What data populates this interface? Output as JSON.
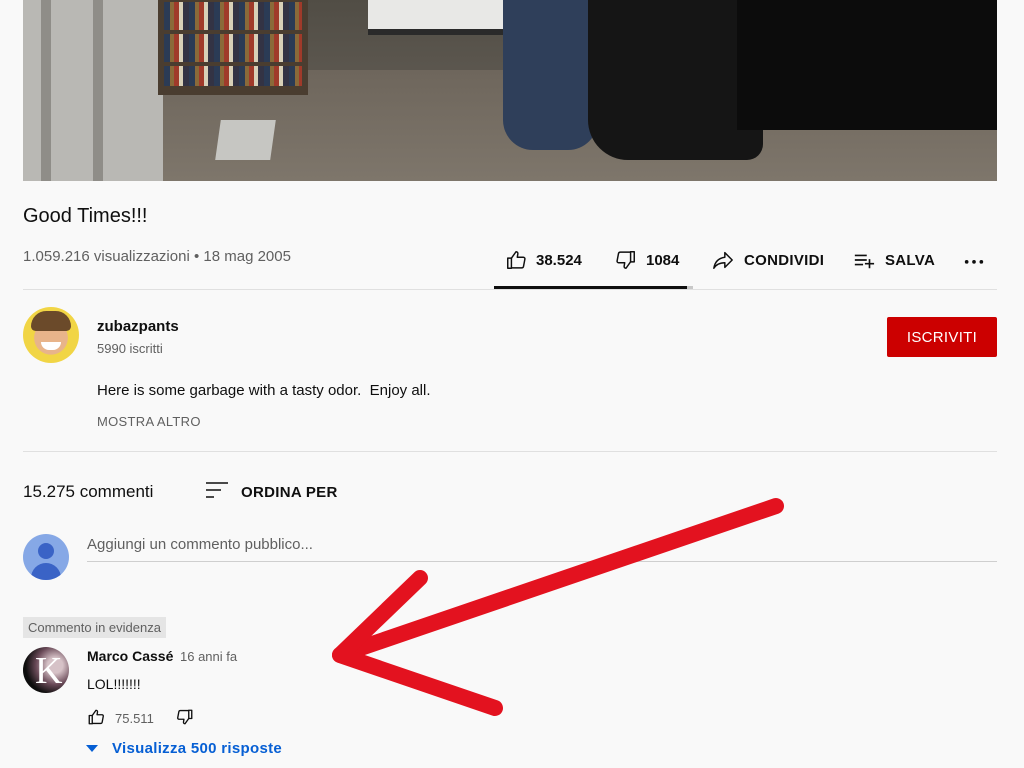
{
  "video": {
    "title": "Good Times!!!",
    "views": "1.059.216 visualizzazioni",
    "separator": "•",
    "date": "18 mag 2005"
  },
  "actions": {
    "likes": "38.524",
    "dislikes": "1084",
    "share_label": "CONDIVIDI",
    "save_label": "SALVA",
    "like_ratio": 0.97
  },
  "channel": {
    "name": "zubazpants",
    "subscribers": "5990 iscritti",
    "subscribe_label": "ISCRIVITI",
    "description": "Here is some garbage with a tasty odor.  Enjoy all.",
    "show_more": "MOSTRA ALTRO"
  },
  "comments": {
    "count": "15.275 commenti",
    "sort_label": "ORDINA PER",
    "add_placeholder": "Aggiungi un commento pubblico...",
    "pinned": {
      "badge": "Commento in evidenza",
      "author": "Marco Cassé",
      "time": "16 anni fa",
      "text": "LOL!!!!!!!",
      "likes": "75.511",
      "replies_label": "Visualizza 500 risposte"
    }
  },
  "colors": {
    "subscribe": "#cc0000",
    "link": "#065fd4",
    "annotation_arrow": "#e3121f"
  },
  "icons": [
    "like-icon",
    "dislike-icon",
    "share-icon",
    "save-playlist-icon",
    "more-icon",
    "sort-icon",
    "user-avatar-icon",
    "caret-down-icon"
  ]
}
